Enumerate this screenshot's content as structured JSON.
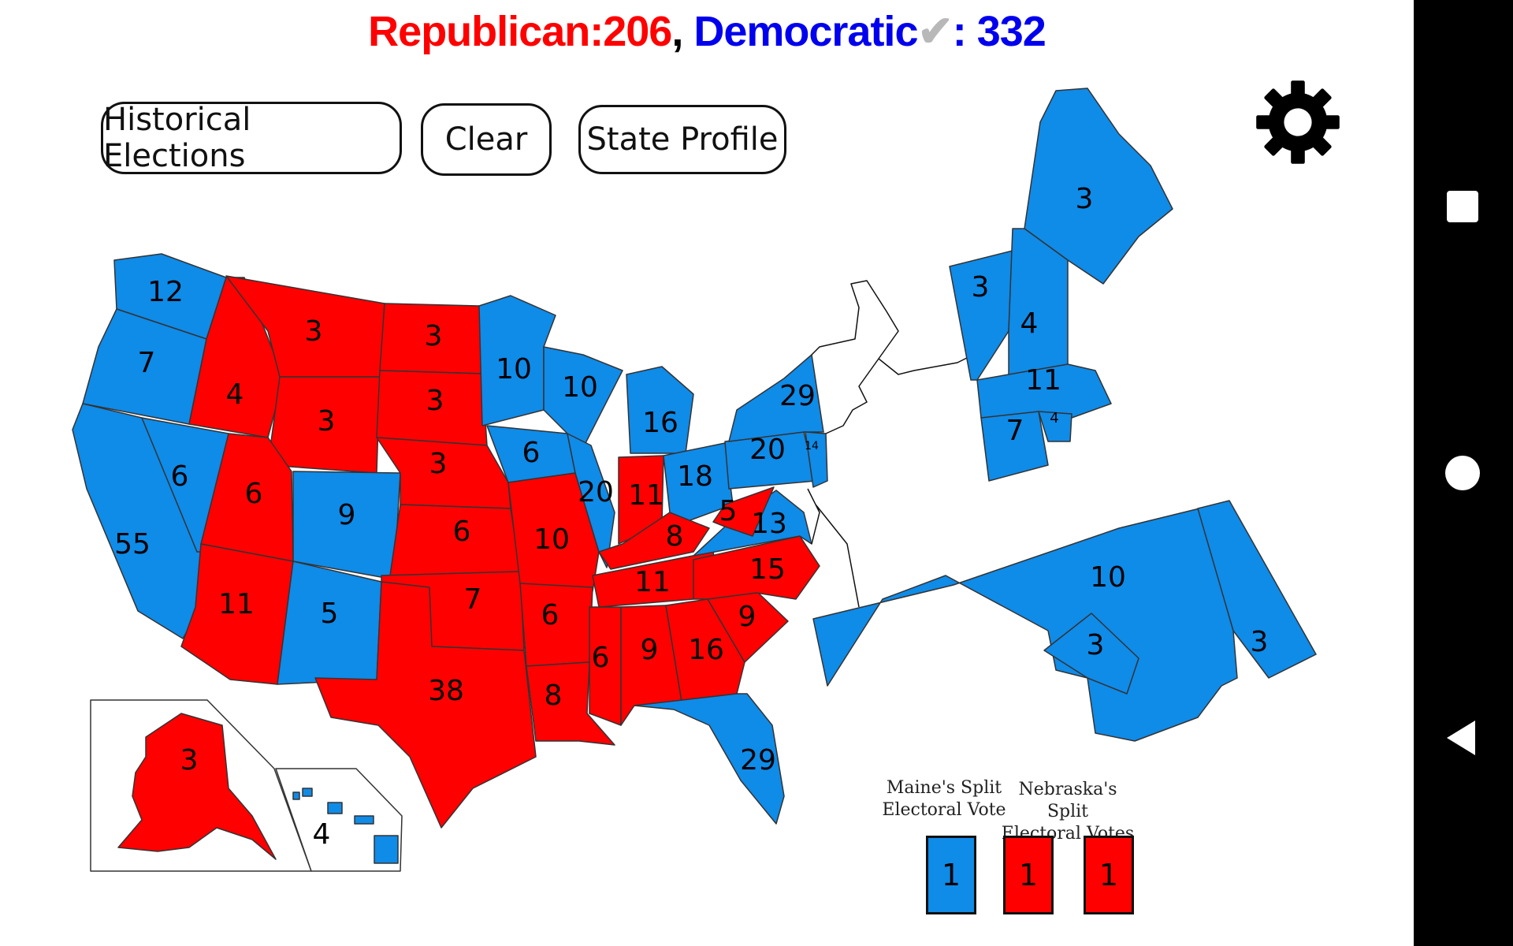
{
  "header": {
    "republican_label": "Republican:",
    "republican_count": "206",
    "separator": ",",
    "democratic_label": "Democratic",
    "check_icon": "✔",
    "democratic_count": ": 332"
  },
  "toolbar": {
    "historical_label": "Historical Elections",
    "clear_label": "Clear",
    "profile_label": "State Profile",
    "settings_icon": "gear-icon"
  },
  "colors": {
    "republican": "#ff0000",
    "democratic": "#0f8be8",
    "neutral": "#ffffff"
  },
  "states": {
    "WA": {
      "votes": "12",
      "party": "D"
    },
    "OR": {
      "votes": "7",
      "party": "D"
    },
    "CA": {
      "votes": "55",
      "party": "D"
    },
    "NV": {
      "votes": "6",
      "party": "D"
    },
    "ID": {
      "votes": "4",
      "party": "R"
    },
    "MT": {
      "votes": "3",
      "party": "R"
    },
    "WY": {
      "votes": "3",
      "party": "R"
    },
    "UT": {
      "votes": "6",
      "party": "R"
    },
    "AZ": {
      "votes": "11",
      "party": "R"
    },
    "CO": {
      "votes": "9",
      "party": "D"
    },
    "NM": {
      "votes": "5",
      "party": "D"
    },
    "ND": {
      "votes": "3",
      "party": "R"
    },
    "SD": {
      "votes": "3",
      "party": "R"
    },
    "NE": {
      "votes": "3",
      "party": "R"
    },
    "KS": {
      "votes": "6",
      "party": "R"
    },
    "OK": {
      "votes": "7",
      "party": "R"
    },
    "TX": {
      "votes": "38",
      "party": "R"
    },
    "MN": {
      "votes": "10",
      "party": "D"
    },
    "IA": {
      "votes": "6",
      "party": "D"
    },
    "MO": {
      "votes": "10",
      "party": "R"
    },
    "AR": {
      "votes": "6",
      "party": "R"
    },
    "LA": {
      "votes": "8",
      "party": "R"
    },
    "WI": {
      "votes": "10",
      "party": "D"
    },
    "IL": {
      "votes": "20",
      "party": "D"
    },
    "MI": {
      "votes": "16",
      "party": "D"
    },
    "IN": {
      "votes": "11",
      "party": "R"
    },
    "OH": {
      "votes": "18",
      "party": "D"
    },
    "KY": {
      "votes": "8",
      "party": "R"
    },
    "TN": {
      "votes": "11",
      "party": "R"
    },
    "MS": {
      "votes": "6",
      "party": "R"
    },
    "AL": {
      "votes": "9",
      "party": "R"
    },
    "GA": {
      "votes": "16",
      "party": "R"
    },
    "FL": {
      "votes": "29",
      "party": "D"
    },
    "SC": {
      "votes": "9",
      "party": "R"
    },
    "NC": {
      "votes": "15",
      "party": "R"
    },
    "VA": {
      "votes": "13",
      "party": "D"
    },
    "WV": {
      "votes": "5",
      "party": "R"
    },
    "PA": {
      "votes": "20",
      "party": "D"
    },
    "NY": {
      "votes": "29",
      "party": "D"
    },
    "NJ": {
      "votes": "14",
      "party": "D"
    },
    "AK": {
      "votes": "3",
      "party": "R"
    },
    "HI": {
      "votes": "4",
      "party": "D"
    },
    "ME": {
      "votes": "3",
      "party": "D"
    },
    "VT": {
      "votes": "3",
      "party": "D"
    },
    "NH": {
      "votes": "4",
      "party": "D"
    },
    "MA": {
      "votes": "11",
      "party": "D"
    },
    "CT": {
      "votes": "7",
      "party": "D"
    },
    "RI": {
      "votes": "4",
      "party": "D"
    },
    "MD": {
      "votes": "10",
      "party": "D"
    },
    "DE": {
      "votes": "3",
      "party": "D"
    },
    "DC": {
      "votes": "3",
      "party": "D"
    }
  },
  "legend": {
    "maine_label_1": "Maine's Split",
    "maine_label_2": "Electoral Vote",
    "nebraska_label_1": "Nebraska's Split",
    "nebraska_label_2": "Electoral Votes",
    "maine_split": {
      "votes": "1",
      "party": "D"
    },
    "nebraska_split_1": {
      "votes": "1",
      "party": "R"
    },
    "nebraska_split_2": {
      "votes": "1",
      "party": "R"
    }
  },
  "navbar": {
    "square_icon": "recent-apps-icon",
    "circle_icon": "home-icon",
    "triangle_icon": "back-icon"
  }
}
